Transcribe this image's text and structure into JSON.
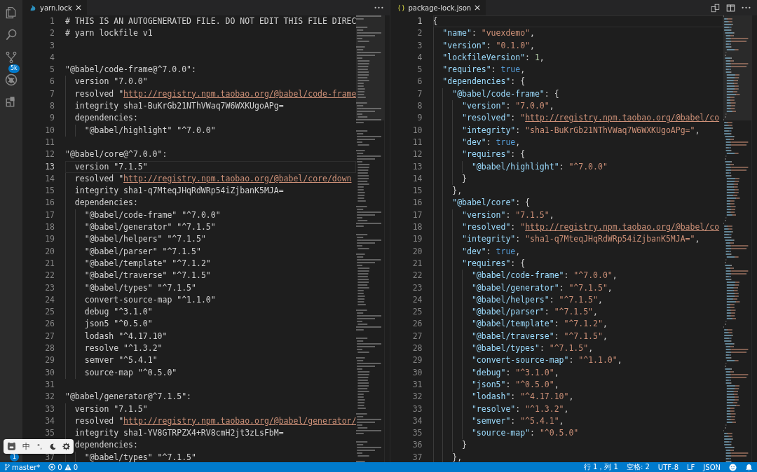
{
  "activity_bar": {
    "source_control_badge": "5k",
    "accounts_badge": "1"
  },
  "ime_toolbar": {
    "language": "中",
    "punctuation": "°,"
  },
  "editors": [
    {
      "tab": {
        "label": "yarn.lock",
        "selected": true
      },
      "lines": [
        {
          "number": "1",
          "current": false,
          "tokens": [
            {
              "kind": "text",
              "text": "# THIS IS AN AUTOGENERATED FILE. DO NOT EDIT THIS FILE DIREC"
            }
          ]
        },
        {
          "number": "2",
          "current": false,
          "tokens": [
            {
              "kind": "text",
              "text": "# yarn lockfile v1"
            }
          ]
        },
        {
          "number": "3",
          "current": false
        },
        {
          "number": "4",
          "current": false
        },
        {
          "number": "5",
          "current": false,
          "tokens": [
            {
              "kind": "text",
              "text": "\"@babel/code-frame@^7.0.0\":"
            }
          ]
        },
        {
          "number": "6",
          "current": false,
          "tokens": [
            {
              "kind": "text",
              "text": "  version \"7.0.0\""
            }
          ]
        },
        {
          "number": "7",
          "current": false,
          "tokens": [
            {
              "kind": "text",
              "text": "  resolved \""
            },
            {
              "kind": "link",
              "text": "http://registry.npm.taobao.org/@babel/code-frame"
            }
          ]
        },
        {
          "number": "8",
          "current": false,
          "tokens": [
            {
              "kind": "text",
              "text": "  integrity sha1-BuKrGb21NThVWaq7W6WXKUgoAPg="
            }
          ]
        },
        {
          "number": "9",
          "current": false,
          "tokens": [
            {
              "kind": "text",
              "text": "  dependencies:"
            }
          ]
        },
        {
          "number": "10",
          "current": false,
          "tokens": [
            {
              "kind": "text",
              "text": "    \"@babel/highlight\" \"^7.0.0\""
            }
          ]
        },
        {
          "number": "11",
          "current": false
        },
        {
          "number": "12",
          "current": false,
          "tokens": [
            {
              "kind": "text",
              "text": "\"@babel/core@^7.0.0\":"
            }
          ]
        },
        {
          "number": "13",
          "current": true,
          "tokens": [
            {
              "kind": "text",
              "text": "  version \"7.1.5\""
            }
          ]
        },
        {
          "number": "14",
          "current": false,
          "tokens": [
            {
              "kind": "text",
              "text": "  resolved \""
            },
            {
              "kind": "link",
              "text": "http://registry.npm.taobao.org/@babel/core/down"
            }
          ]
        },
        {
          "number": "15",
          "current": false,
          "tokens": [
            {
              "kind": "text",
              "text": "  integrity sha1-q7MteqJHqRdWRp54iZjbanK5MJA="
            }
          ]
        },
        {
          "number": "16",
          "current": false,
          "tokens": [
            {
              "kind": "text",
              "text": "  dependencies:"
            }
          ]
        },
        {
          "number": "17",
          "current": false,
          "tokens": [
            {
              "kind": "text",
              "text": "    \"@babel/code-frame\" \"^7.0.0\""
            }
          ]
        },
        {
          "number": "18",
          "current": false,
          "tokens": [
            {
              "kind": "text",
              "text": "    \"@babel/generator\" \"^7.1.5\""
            }
          ]
        },
        {
          "number": "19",
          "current": false,
          "tokens": [
            {
              "kind": "text",
              "text": "    \"@babel/helpers\" \"^7.1.5\""
            }
          ]
        },
        {
          "number": "20",
          "current": false,
          "tokens": [
            {
              "kind": "text",
              "text": "    \"@babel/parser\" \"^7.1.5\""
            }
          ]
        },
        {
          "number": "21",
          "current": false,
          "tokens": [
            {
              "kind": "text",
              "text": "    \"@babel/template\" \"^7.1.2\""
            }
          ]
        },
        {
          "number": "22",
          "current": false,
          "tokens": [
            {
              "kind": "text",
              "text": "    \"@babel/traverse\" \"^7.1.5\""
            }
          ]
        },
        {
          "number": "23",
          "current": false,
          "tokens": [
            {
              "kind": "text",
              "text": "    \"@babel/types\" \"^7.1.5\""
            }
          ]
        },
        {
          "number": "24",
          "current": false,
          "tokens": [
            {
              "kind": "text",
              "text": "    convert-source-map \"^1.1.0\""
            }
          ]
        },
        {
          "number": "25",
          "current": false,
          "tokens": [
            {
              "kind": "text",
              "text": "    debug \"^3.1.0\""
            }
          ]
        },
        {
          "number": "26",
          "current": false,
          "tokens": [
            {
              "kind": "text",
              "text": "    json5 \"^0.5.0\""
            }
          ]
        },
        {
          "number": "27",
          "current": false,
          "tokens": [
            {
              "kind": "text",
              "text": "    lodash \"^4.17.10\""
            }
          ]
        },
        {
          "number": "28",
          "current": false,
          "tokens": [
            {
              "kind": "text",
              "text": "    resolve \"^1.3.2\""
            }
          ]
        },
        {
          "number": "29",
          "current": false,
          "tokens": [
            {
              "kind": "text",
              "text": "    semver \"^5.4.1\""
            }
          ]
        },
        {
          "number": "30",
          "current": false,
          "tokens": [
            {
              "kind": "text",
              "text": "    source-map \"^0.5.0\""
            }
          ]
        },
        {
          "number": "31",
          "current": false
        },
        {
          "number": "32",
          "current": false,
          "tokens": [
            {
              "kind": "text",
              "text": "\"@babel/generator@^7.1.5\":"
            }
          ]
        },
        {
          "number": "33",
          "current": false,
          "tokens": [
            {
              "kind": "text",
              "text": "  version \"7.1.5\""
            }
          ]
        },
        {
          "number": "34",
          "current": false,
          "tokens": [
            {
              "kind": "text",
              "text": "  resolved \""
            },
            {
              "kind": "link",
              "text": "http://registry.npm.taobao.org/@babel/generator/"
            }
          ]
        },
        {
          "number": "35",
          "current": false,
          "tokens": [
            {
              "kind": "text",
              "text": "  integrity sha1-YV8GTRPZX4+RV8cmH2jt3zLsFbM="
            }
          ]
        },
        {
          "tokens": [
            {
              "kind": "text",
              "text": "  dependencies:"
            }
          ]
        },
        {
          "number": "37",
          "current": false,
          "tokens": [
            {
              "kind": "text",
              "text": "    \"@babel/types\" \"^7.1.5\""
            }
          ]
        }
      ]
    },
    {
      "tab": {
        "label": "package-lock.json",
        "selected": true
      },
      "lines": [
        {
          "number": "1",
          "current": true,
          "tokens": [
            {
              "kind": "punct",
              "text": "{"
            }
          ]
        },
        {
          "number": "2",
          "current": false,
          "tokens": [
            {
              "kind": "key",
              "text": "  \"name\""
            },
            {
              "kind": "punct",
              "text": ": "
            },
            {
              "kind": "string",
              "text": "\"vuexdemo\""
            },
            {
              "kind": "punct",
              "text": ","
            }
          ]
        },
        {
          "number": "3",
          "current": false,
          "tokens": [
            {
              "kind": "key",
              "text": "  \"version\""
            },
            {
              "kind": "punct",
              "text": ": "
            },
            {
              "kind": "string",
              "text": "\"0.1.0\""
            },
            {
              "kind": "punct",
              "text": ","
            }
          ]
        },
        {
          "number": "4",
          "current": false,
          "tokens": [
            {
              "kind": "key",
              "text": "  \"lockfileVersion\""
            },
            {
              "kind": "punct",
              "text": ": "
            },
            {
              "kind": "number",
              "text": "1"
            },
            {
              "kind": "punct",
              "text": ","
            }
          ]
        },
        {
          "number": "5",
          "current": false,
          "tokens": [
            {
              "kind": "key",
              "text": "  \"requires\""
            },
            {
              "kind": "punct",
              "text": ": "
            },
            {
              "kind": "boolean",
              "text": "true"
            },
            {
              "kind": "punct",
              "text": ","
            }
          ]
        },
        {
          "number": "6",
          "current": false,
          "tokens": [
            {
              "kind": "key",
              "text": "  \"dependencies\""
            },
            {
              "kind": "punct",
              "text": ": {"
            }
          ]
        },
        {
          "number": "7",
          "current": false,
          "tokens": [
            {
              "kind": "key",
              "text": "    \"@babel/code-frame\""
            },
            {
              "kind": "punct",
              "text": ": {"
            }
          ]
        },
        {
          "number": "8",
          "current": false,
          "tokens": [
            {
              "kind": "key",
              "text": "      \"version\""
            },
            {
              "kind": "punct",
              "text": ": "
            },
            {
              "kind": "string",
              "text": "\"7.0.0\""
            },
            {
              "kind": "punct",
              "text": ","
            }
          ]
        },
        {
          "number": "9",
          "current": false,
          "tokens": [
            {
              "kind": "key",
              "text": "      \"resolved\""
            },
            {
              "kind": "punct",
              "text": ": "
            },
            {
              "kind": "string",
              "text": "\""
            },
            {
              "kind": "link",
              "text": "http://registry.npm.taobao.org/@babel/co"
            }
          ]
        },
        {
          "number": "10",
          "current": false,
          "tokens": [
            {
              "kind": "key",
              "text": "      \"integrity\""
            },
            {
              "kind": "punct",
              "text": ": "
            },
            {
              "kind": "string",
              "text": "\"sha1-BuKrGb21NThVWaq7W6WXKUgoAPg=\""
            },
            {
              "kind": "punct",
              "text": ","
            }
          ]
        },
        {
          "number": "11",
          "current": false,
          "tokens": [
            {
              "kind": "key",
              "text": "      \"dev\""
            },
            {
              "kind": "punct",
              "text": ": "
            },
            {
              "kind": "boolean",
              "text": "true"
            },
            {
              "kind": "punct",
              "text": ","
            }
          ]
        },
        {
          "number": "12",
          "current": false,
          "tokens": [
            {
              "kind": "key",
              "text": "      \"requires\""
            },
            {
              "kind": "punct",
              "text": ": {"
            }
          ]
        },
        {
          "number": "13",
          "current": false,
          "tokens": [
            {
              "kind": "key",
              "text": "        \"@babel/highlight\""
            },
            {
              "kind": "punct",
              "text": ": "
            },
            {
              "kind": "string",
              "text": "\"^7.0.0\""
            }
          ]
        },
        {
          "number": "14",
          "current": false,
          "tokens": [
            {
              "kind": "punct",
              "text": "      }"
            }
          ]
        },
        {
          "number": "15",
          "current": false,
          "tokens": [
            {
              "kind": "punct",
              "text": "    },"
            }
          ]
        },
        {
          "number": "16",
          "current": false,
          "tokens": [
            {
              "kind": "key",
              "text": "    \"@babel/core\""
            },
            {
              "kind": "punct",
              "text": ": {"
            }
          ]
        },
        {
          "number": "17",
          "current": false,
          "tokens": [
            {
              "kind": "key",
              "text": "      \"version\""
            },
            {
              "kind": "punct",
              "text": ": "
            },
            {
              "kind": "string",
              "text": "\"7.1.5\""
            },
            {
              "kind": "punct",
              "text": ","
            }
          ]
        },
        {
          "number": "18",
          "current": false,
          "tokens": [
            {
              "kind": "key",
              "text": "      \"resolved\""
            },
            {
              "kind": "punct",
              "text": ": "
            },
            {
              "kind": "string",
              "text": "\""
            },
            {
              "kind": "link",
              "text": "http://registry.npm.taobao.org/@babel/co"
            }
          ]
        },
        {
          "number": "19",
          "current": false,
          "tokens": [
            {
              "kind": "key",
              "text": "      \"integrity\""
            },
            {
              "kind": "punct",
              "text": ": "
            },
            {
              "kind": "string",
              "text": "\"sha1-q7MteqJHqRdWRp54iZjbanK5MJA=\""
            },
            {
              "kind": "punct",
              "text": ","
            }
          ]
        },
        {
          "number": "20",
          "current": false,
          "tokens": [
            {
              "kind": "key",
              "text": "      \"dev\""
            },
            {
              "kind": "punct",
              "text": ": "
            },
            {
              "kind": "boolean",
              "text": "true"
            },
            {
              "kind": "punct",
              "text": ","
            }
          ]
        },
        {
          "number": "21",
          "current": false,
          "tokens": [
            {
              "kind": "key",
              "text": "      \"requires\""
            },
            {
              "kind": "punct",
              "text": ": {"
            }
          ]
        },
        {
          "number": "22",
          "current": false,
          "tokens": [
            {
              "kind": "key",
              "text": "        \"@babel/code-frame\""
            },
            {
              "kind": "punct",
              "text": ": "
            },
            {
              "kind": "string",
              "text": "\"^7.0.0\""
            },
            {
              "kind": "punct",
              "text": ","
            }
          ]
        },
        {
          "number": "23",
          "current": false,
          "tokens": [
            {
              "kind": "key",
              "text": "        \"@babel/generator\""
            },
            {
              "kind": "punct",
              "text": ": "
            },
            {
              "kind": "string",
              "text": "\"^7.1.5\""
            },
            {
              "kind": "punct",
              "text": ","
            }
          ]
        },
        {
          "number": "24",
          "current": false,
          "tokens": [
            {
              "kind": "key",
              "text": "        \"@babel/helpers\""
            },
            {
              "kind": "punct",
              "text": ": "
            },
            {
              "kind": "string",
              "text": "\"^7.1.5\""
            },
            {
              "kind": "punct",
              "text": ","
            }
          ]
        },
        {
          "number": "25",
          "current": false,
          "tokens": [
            {
              "kind": "key",
              "text": "        \"@babel/parser\""
            },
            {
              "kind": "punct",
              "text": ": "
            },
            {
              "kind": "string",
              "text": "\"^7.1.5\""
            },
            {
              "kind": "punct",
              "text": ","
            }
          ]
        },
        {
          "number": "26",
          "current": false,
          "tokens": [
            {
              "kind": "key",
              "text": "        \"@babel/template\""
            },
            {
              "kind": "punct",
              "text": ": "
            },
            {
              "kind": "string",
              "text": "\"^7.1.2\""
            },
            {
              "kind": "punct",
              "text": ","
            }
          ]
        },
        {
          "number": "27",
          "current": false,
          "tokens": [
            {
              "kind": "key",
              "text": "        \"@babel/traverse\""
            },
            {
              "kind": "punct",
              "text": ": "
            },
            {
              "kind": "string",
              "text": "\"^7.1.5\""
            },
            {
              "kind": "punct",
              "text": ","
            }
          ]
        },
        {
          "number": "28",
          "current": false,
          "tokens": [
            {
              "kind": "key",
              "text": "        \"@babel/types\""
            },
            {
              "kind": "punct",
              "text": ": "
            },
            {
              "kind": "string",
              "text": "\"^7.1.5\""
            },
            {
              "kind": "punct",
              "text": ","
            }
          ]
        },
        {
          "number": "29",
          "current": false,
          "tokens": [
            {
              "kind": "key",
              "text": "        \"convert-source-map\""
            },
            {
              "kind": "punct",
              "text": ": "
            },
            {
              "kind": "string",
              "text": "\"^1.1.0\""
            },
            {
              "kind": "punct",
              "text": ","
            }
          ]
        },
        {
          "number": "30",
          "current": false,
          "tokens": [
            {
              "kind": "key",
              "text": "        \"debug\""
            },
            {
              "kind": "punct",
              "text": ": "
            },
            {
              "kind": "string",
              "text": "\"^3.1.0\""
            },
            {
              "kind": "punct",
              "text": ","
            }
          ]
        },
        {
          "number": "31",
          "current": false,
          "tokens": [
            {
              "kind": "key",
              "text": "        \"json5\""
            },
            {
              "kind": "punct",
              "text": ": "
            },
            {
              "kind": "string",
              "text": "\"^0.5.0\""
            },
            {
              "kind": "punct",
              "text": ","
            }
          ]
        },
        {
          "number": "32",
          "current": false,
          "tokens": [
            {
              "kind": "key",
              "text": "        \"lodash\""
            },
            {
              "kind": "punct",
              "text": ": "
            },
            {
              "kind": "string",
              "text": "\"^4.17.10\""
            },
            {
              "kind": "punct",
              "text": ","
            }
          ]
        },
        {
          "number": "33",
          "current": false,
          "tokens": [
            {
              "kind": "key",
              "text": "        \"resolve\""
            },
            {
              "kind": "punct",
              "text": ": "
            },
            {
              "kind": "string",
              "text": "\"^1.3.2\""
            },
            {
              "kind": "punct",
              "text": ","
            }
          ]
        },
        {
          "number": "34",
          "current": false,
          "tokens": [
            {
              "kind": "key",
              "text": "        \"semver\""
            },
            {
              "kind": "punct",
              "text": ": "
            },
            {
              "kind": "string",
              "text": "\"^5.4.1\""
            },
            {
              "kind": "punct",
              "text": ","
            }
          ]
        },
        {
          "number": "35",
          "current": false,
          "tokens": [
            {
              "kind": "key",
              "text": "        \"source-map\""
            },
            {
              "kind": "punct",
              "text": ": "
            },
            {
              "kind": "string",
              "text": "\"^0.5.0\""
            }
          ]
        },
        {
          "number": "36",
          "current": false,
          "tokens": [
            {
              "kind": "punct",
              "text": "      }"
            }
          ]
        },
        {
          "number": "37",
          "current": false,
          "tokens": [
            {
              "kind": "punct",
              "text": "    },"
            }
          ]
        }
      ]
    }
  ],
  "status_bar": {
    "branch": "master*",
    "errors": "0",
    "warnings": "0",
    "position": "行 1，列 1",
    "indent": "空格: 2",
    "encoding": "UTF-8",
    "eol": "LF",
    "language": "JSON"
  }
}
